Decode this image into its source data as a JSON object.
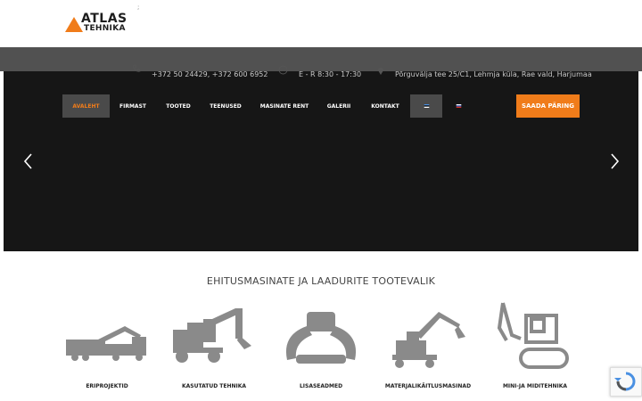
{
  "logo": {
    "line1": "ATLAS",
    "line2": "TEHNIKA",
    "accent": "#f07c1a"
  },
  "header": {
    "phone": "+372 50 24429, +372 600 6952",
    "hours": "E - R 8:30 - 17:30",
    "address": "Põrguvälja tee 25/C1, Lehmja küla, Rae vald, Harjumaa"
  },
  "nav": {
    "items": [
      "AVALEHT",
      "FIRMAST",
      "TOOTED",
      "TEENUSED",
      "MASINATE RENT",
      "GALERII",
      "KONTAKT"
    ],
    "cta": "SAADA PÄRING"
  },
  "section": {
    "title": "EHITUSMASINATE JA LAADURITE TOOTEVALIK",
    "products": [
      "ERIPROJEKTID",
      "KASUTATUD TEHNIKA",
      "LISASEADMED",
      "MATERJALIKÄITLUSMASINAD",
      "MINI-JA MIDITEHNIKA"
    ]
  },
  "icons": [
    "phone-icon",
    "clock-icon",
    "location-icon",
    "estonian-flag-icon",
    "russian-flag-icon",
    "chevron-left-icon",
    "chevron-right-icon",
    "recaptcha-icon"
  ],
  "colors": {
    "accent": "#f07c1a",
    "hero": "#161616",
    "strip": "#515151",
    "icon_gray": "#8a8a8a"
  }
}
